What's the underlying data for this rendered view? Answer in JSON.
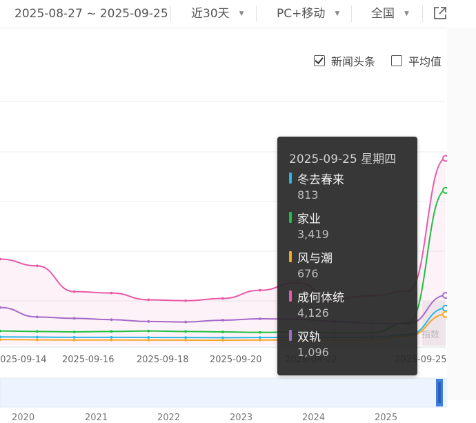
{
  "filters": {
    "date_range": "2025-08-27 ~ 2025-09-25",
    "period": "近30天",
    "platform": "PC+移动",
    "region": "全国"
  },
  "icons": {
    "share": "external-link-icon",
    "caret": "caret-down-icon",
    "checkbox": "checkbox-icon"
  },
  "options": {
    "news_headline": {
      "label": "新闻头条",
      "checked": true
    },
    "average": {
      "label": "平均值",
      "checked": false
    }
  },
  "chart_data": {
    "type": "line",
    "x_ticks": [
      "2025-09-14",
      "2025-09-16",
      "2025-09-18",
      "2025-09-20",
      "2025-09-22",
      "2025-09-25"
    ],
    "navigator_ticks": [
      "2020",
      "2021",
      "2022",
      "2023",
      "2024",
      "2025"
    ],
    "grid": true,
    "ylim": [
      0,
      4500
    ],
    "x": [
      "2025-09-13",
      "2025-09-14",
      "2025-09-15",
      "2025-09-16",
      "2025-09-17",
      "2025-09-18",
      "2025-09-19",
      "2025-09-20",
      "2025-09-21",
      "2025-09-22",
      "2025-09-23",
      "2025-09-24",
      "2025-09-25"
    ],
    "series": [
      {
        "name": "冬去春来",
        "color": "#29b6e6",
        "values": [
          180,
          175,
          170,
          170,
          168,
          165,
          162,
          165,
          170,
          168,
          172,
          230,
          813
        ]
      },
      {
        "name": "家业",
        "color": "#1fbf3f",
        "values": [
          310,
          300,
          290,
          300,
          310,
          300,
          290,
          280,
          290,
          270,
          270,
          500,
          3419
        ]
      },
      {
        "name": "风与潮",
        "color": "#f5a623",
        "values": [
          120,
          115,
          110,
          112,
          110,
          108,
          106,
          110,
          112,
          110,
          115,
          200,
          676
        ]
      },
      {
        "name": "成何体统",
        "color": "#e85aa6",
        "values": [
          1900,
          1750,
          1180,
          1150,
          1000,
          980,
          1030,
          1210,
          1380,
          1020,
          1090,
          1200,
          4126
        ]
      },
      {
        "name": "双轨",
        "color": "#a569c8",
        "values": [
          830,
          620,
          590,
          560,
          520,
          510,
          550,
          580,
          570,
          520,
          480,
          470,
          1096
        ]
      }
    ],
    "tooltip": {
      "date": "2025-09-25 星期四",
      "items": [
        {
          "name": "冬去春来",
          "value": "813"
        },
        {
          "name": "家业",
          "value": "3,419"
        },
        {
          "name": "风与潮",
          "value": "676"
        },
        {
          "name": "成何体统",
          "value": "4,126"
        },
        {
          "name": "双轨",
          "value": "1,096"
        }
      ]
    },
    "overlay_label": "指数"
  }
}
